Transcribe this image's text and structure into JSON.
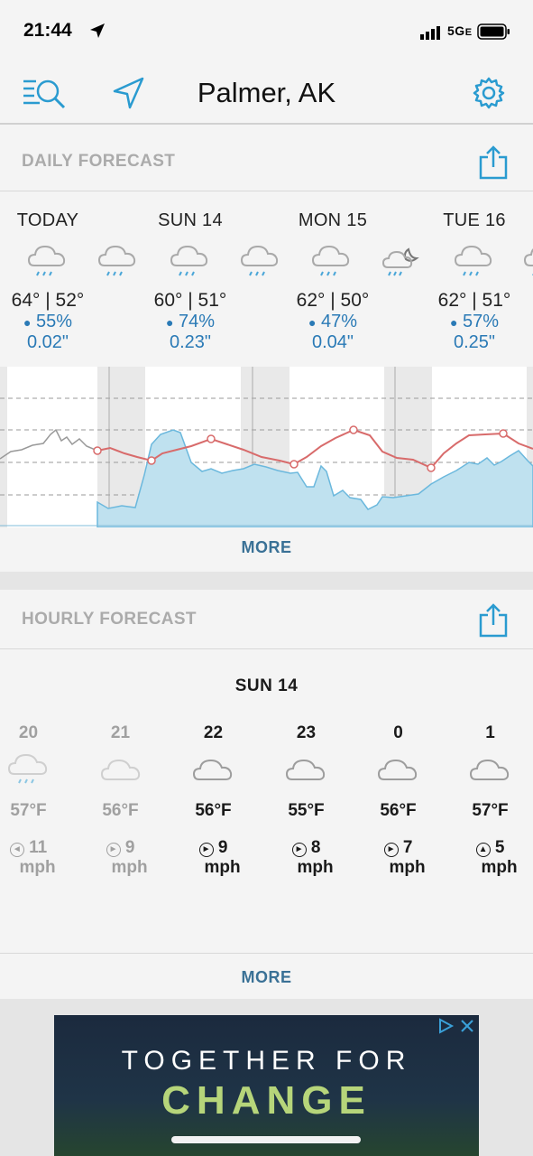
{
  "status_bar": {
    "time": "21:44",
    "network": "5G",
    "network_suffix": "E"
  },
  "nav": {
    "city": "Palmer, AK"
  },
  "daily": {
    "title": "DAILY FORECAST",
    "more": "MORE",
    "days": [
      {
        "label": "TODAY",
        "temps": "64° | 52°",
        "precip": "55%",
        "amount": "0.02\""
      },
      {
        "label": "SUN 14",
        "temps": "60° | 51°",
        "precip": "74%",
        "amount": "0.23\""
      },
      {
        "label": "MON 15",
        "temps": "62° | 50°",
        "precip": "47%",
        "amount": "0.04\""
      },
      {
        "label": "TUE 16",
        "temps": "62° | 51°",
        "precip": "57%",
        "amount": "0.25\""
      }
    ]
  },
  "hourly": {
    "title": "HOURLY FORECAST",
    "date": "SUN 14",
    "more": "MORE",
    "hours": [
      {
        "hour": "20",
        "temp": "57°F",
        "wind": "11",
        "unit": "mph"
      },
      {
        "hour": "21",
        "temp": "56°F",
        "wind": "9",
        "unit": "mph"
      },
      {
        "hour": "22",
        "temp": "56°F",
        "wind": "9",
        "unit": "mph"
      },
      {
        "hour": "23",
        "temp": "55°F",
        "wind": "8",
        "unit": "mph"
      },
      {
        "hour": "0",
        "temp": "56°F",
        "wind": "7",
        "unit": "mph"
      },
      {
        "hour": "1",
        "temp": "57°F",
        "wind": "5",
        "unit": "mph"
      }
    ]
  },
  "ad": {
    "line1": "TOGETHER FOR",
    "line2": "CHANGE"
  },
  "colors": {
    "accent": "#2a9bd0",
    "precip_text": "#2a7ab6",
    "temp_line": "#d86b6b",
    "precip_fill": "#bfe1ef",
    "more_link": "#3a7196"
  },
  "icons": [
    "search-list-icon",
    "location-arrow-icon",
    "settings-gear-icon",
    "share-icon",
    "rain-cloud-icon",
    "cloud-icon",
    "night-rain-icon",
    "raindrop-icon",
    "wind-direction-icon"
  ]
}
